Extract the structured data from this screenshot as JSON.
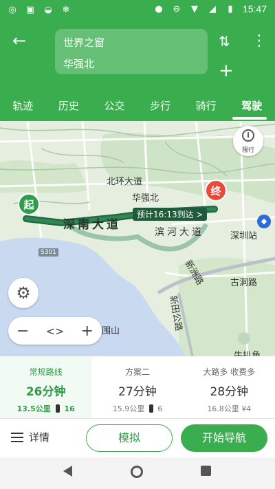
{
  "status_bar": {
    "time": "15:47",
    "left_icons": [
      "app-icon",
      "image-icon",
      "cat-icon",
      "snowflake-icon"
    ],
    "right_icons": [
      "location-icon",
      "dnd-icon",
      "wifi-icon",
      "signal-icon",
      "battery-icon"
    ]
  },
  "header": {
    "from": "世界之窗",
    "to": "华强北"
  },
  "tabs": [
    {
      "label": "轨迹"
    },
    {
      "label": "历史"
    },
    {
      "label": "公交"
    },
    {
      "label": "步行"
    },
    {
      "label": "骑行"
    },
    {
      "label": "驾驶"
    }
  ],
  "active_tab": "驾驶",
  "map": {
    "road_badge": "S301",
    "limit_label": "限行",
    "labels": {
      "north_ring": "北环大道",
      "huaqiangbei": "华强北",
      "shennan": "深南大道",
      "binhe": "滨河大道",
      "xinzhou": "新洲路",
      "xintian": "新田公路",
      "gudonglu": "古洞路",
      "shenzhen": "深圳站",
      "weishan": "围山",
      "niubao": "牛扒角"
    },
    "eta_tag": "预计16:13到达 >",
    "start_pin": "起",
    "end_pin": "终",
    "zoom_out": "−",
    "zoom_mid": "<>",
    "zoom_in": "+"
  },
  "plans": [
    {
      "name": "常规路线",
      "duration": "26分钟",
      "distance": "13.5公里",
      "lights": "16"
    },
    {
      "name": "方案二",
      "duration": "27分钟",
      "distance": "15.9公里",
      "lights": "6"
    },
    {
      "name": "大路多 收费多",
      "duration": "28分钟",
      "distance": "16.8公里",
      "toll": "¥4"
    }
  ],
  "actions": {
    "details": "详情",
    "simulate": "模拟",
    "start_nav": "开始导航"
  },
  "colors": {
    "brand_green": "#3aae4e",
    "route_dark": "#1f5b3a",
    "end_red": "#e64b3c"
  }
}
